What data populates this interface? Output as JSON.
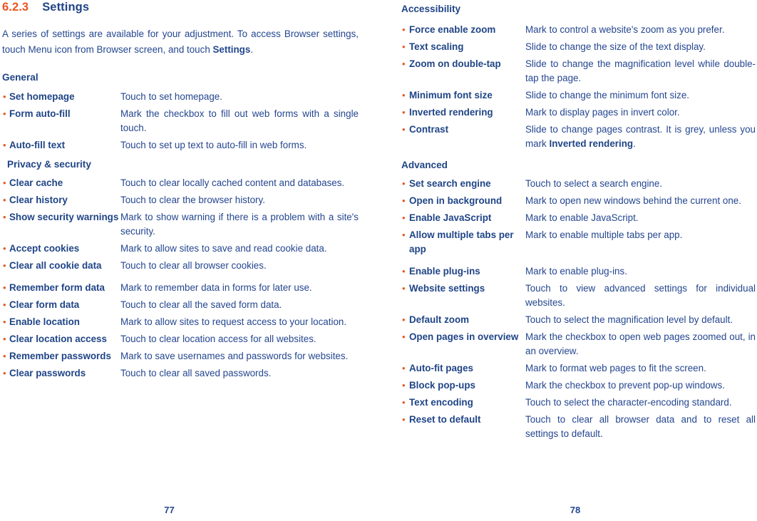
{
  "document": {
    "section_number": "6.2.3",
    "section_title": "Settings",
    "intro": "A series of settings are available for your adjustment. To access Browser settings, touch Menu icon from Browser screen, and touch ",
    "intro_bold": "Settings",
    "intro_end": "."
  },
  "left_page": {
    "folio": "77",
    "groups": [
      {
        "heading": "General",
        "rows": [
          {
            "term": "Set homepage",
            "desc": "Touch to set homepage."
          },
          {
            "term": "Form auto-fill",
            "desc": "Mark the checkbox to fill out web forms with a single touch."
          },
          {
            "term": "Auto-fill text",
            "desc": "Touch to set up text to auto-fill in web forms."
          }
        ]
      },
      {
        "heading": "Privacy & security",
        "rows": [
          {
            "term": "Clear cache",
            "desc": "Touch to clear locally cached content and databases."
          },
          {
            "term": "Clear history",
            "desc": "Touch to clear the browser history."
          },
          {
            "term": "Show security warnings",
            "desc": "Mark to show warning if there is a problem with a site's security."
          },
          {
            "term": "Accept cookies",
            "desc": "Mark to allow sites to save and read cookie data."
          },
          {
            "term": "Clear all cookie data",
            "desc": "Touch to clear all browser cookies."
          },
          {
            "term": "Remember form data",
            "desc": "Mark to remember data in forms for later use."
          },
          {
            "term": "Clear form data",
            "desc": "Touch to clear all the saved form data."
          },
          {
            "term": "Enable location",
            "desc": "Mark to allow sites to request access to your location."
          },
          {
            "term": "Clear location access",
            "desc": "Touch to clear location access for all websites."
          },
          {
            "term": "Remember passwords",
            "desc": "Mark to save usernames and passwords for websites."
          },
          {
            "term": "Clear passwords",
            "desc": "Touch to clear all saved passwords."
          }
        ]
      }
    ]
  },
  "right_page": {
    "folio": "78",
    "groups": [
      {
        "heading": "Accessibility",
        "rows": [
          {
            "term": "Force enable zoom",
            "desc": "Mark to control a website's zoom as you prefer."
          },
          {
            "term": "Text scaling",
            "desc": "Slide to change the size of the text display."
          },
          {
            "term": "Zoom on double-tap",
            "desc": "Slide to change the magnification level while double-tap the page."
          },
          {
            "term": "Minimum font size",
            "desc": "Slide to change the minimum font size."
          },
          {
            "term": "Inverted rendering",
            "desc": "Mark to display pages in invert color."
          },
          {
            "term": "Contrast",
            "desc": "Slide to change pages contrast. It is grey, unless you mark ",
            "desc_bold": "Inverted rendering",
            "desc_end": "."
          }
        ]
      },
      {
        "heading": "Advanced",
        "rows": [
          {
            "term": "Set search engine",
            "desc": "Touch to select a search engine."
          },
          {
            "term": "Open in background",
            "desc": "Mark to open new windows behind the current one."
          },
          {
            "term": "Enable JavaScript",
            "desc": "Mark to enable JavaScript."
          },
          {
            "term": "Allow multiple tabs per app",
            "desc": "Mark to enable multiple tabs per app."
          },
          {
            "term": "Enable plug-ins",
            "desc": "Mark to enable plug-ins."
          },
          {
            "term": "Website settings",
            "desc": "Touch to view advanced settings for individual websites."
          },
          {
            "term": "Default zoom",
            "desc": "Touch to select the magnification level by default."
          },
          {
            "term": "Open pages in overview",
            "desc": "Mark the checkbox to open web pages zoomed out, in an overview."
          },
          {
            "term": "Auto-fit pages",
            "desc": "Mark to format web pages to fit the screen."
          },
          {
            "term": "Block pop-ups",
            "desc": "Mark the checkbox to prevent pop-up windows."
          },
          {
            "term": "Text encoding",
            "desc": "Touch to select the character-encoding standard."
          },
          {
            "term": "Reset to default",
            "desc": "Touch to clear all browser data and to reset all settings to default."
          }
        ]
      }
    ]
  },
  "style": {
    "accent_orange": "#E8561F",
    "heading_blue": "#1F4486",
    "body_blue": "#24468F",
    "bullet_glyph": "•"
  }
}
